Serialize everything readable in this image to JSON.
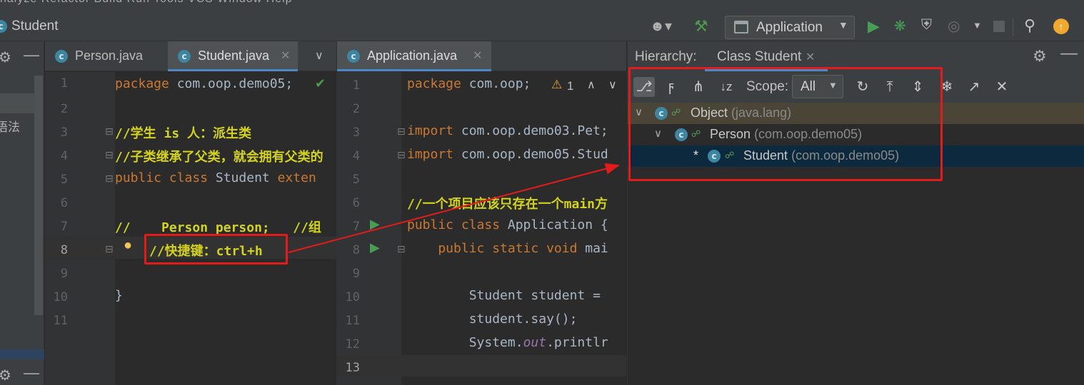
{
  "menubar": {
    "items_text": "nalyze  Refactor  Build  Run  Tools  VCS  Window  Help"
  },
  "navbar": {
    "title": "Student",
    "run_config": "Application",
    "class_icon_letter": "c"
  },
  "left_panel": {
    "text": "语法"
  },
  "editor1": {
    "tabs": [
      {
        "label": "Person.java",
        "icon": "class-icon"
      },
      {
        "label": "Student.java",
        "icon": "class-icon",
        "active": true
      }
    ],
    "line_numbers": [
      "1",
      "2",
      "3",
      "4",
      "5",
      "6",
      "7",
      "8",
      "9",
      "10",
      "11"
    ],
    "lines": [
      {
        "kw": "package",
        "rest": " com.oop.demo05;"
      },
      {
        "text": ""
      },
      {
        "comment": "//学生 is 人：派生类"
      },
      {
        "comment": "//子类继承了父类，就会拥有父类的"
      },
      {
        "kw": "public class",
        "rest": " Student ",
        "kw2": "exten"
      },
      {
        "text": ""
      },
      {
        "comment": "//    Person person;   //组"
      },
      {
        "comment": "//快捷键：ctrl+h"
      },
      {
        "text": ""
      },
      {
        "text": "}"
      },
      {
        "text": ""
      }
    ]
  },
  "editor2": {
    "tabs": [
      {
        "label": "Application.java",
        "icon": "class-icon",
        "active": true
      }
    ],
    "line_numbers": [
      "1",
      "2",
      "3",
      "4",
      "5",
      "6",
      "7",
      "8",
      "9",
      "10",
      "11",
      "12",
      "13"
    ],
    "warning_count": "1",
    "lines": [
      {
        "kw": "package",
        "rest": " com.oop;"
      },
      {
        "text": ""
      },
      {
        "kw": "import",
        "rest": " com.oop.demo03.Pet;"
      },
      {
        "kw": "import",
        "rest": " com.oop.demo05.Stud"
      },
      {
        "text": ""
      },
      {
        "comment": "//一个项目应该只存在一个main方"
      },
      {
        "kw": "public class",
        "rest": " Application {"
      },
      {
        "kw": "    public static void",
        "rest": " mai"
      },
      {
        "text": ""
      },
      {
        "text": "        Student student ="
      },
      {
        "text": "        student.say();"
      },
      {
        "pre": "        System.",
        "ital": "out",
        "post": ".printlr"
      },
      {
        "text": ""
      }
    ]
  },
  "hierarchy": {
    "title": "Hierarchy:",
    "tab": "Class Student",
    "scope_label": "Scope:",
    "scope_value": "All",
    "tree": [
      {
        "name": "Object",
        "package": "(java.lang)",
        "level": 0,
        "expanded": true
      },
      {
        "name": "Person",
        "package": "(com.oop.demo05)",
        "level": 1,
        "expanded": true
      },
      {
        "name": "Student",
        "package": "(com.oop.demo05)",
        "level": 2,
        "marker": "*",
        "selected": true
      }
    ]
  },
  "colors": {
    "annotation_red": "#e51b1b",
    "comment_yellow": "#d3d31f",
    "keyword_orange": "#cc7832",
    "accent_blue": "#4a88c7"
  }
}
